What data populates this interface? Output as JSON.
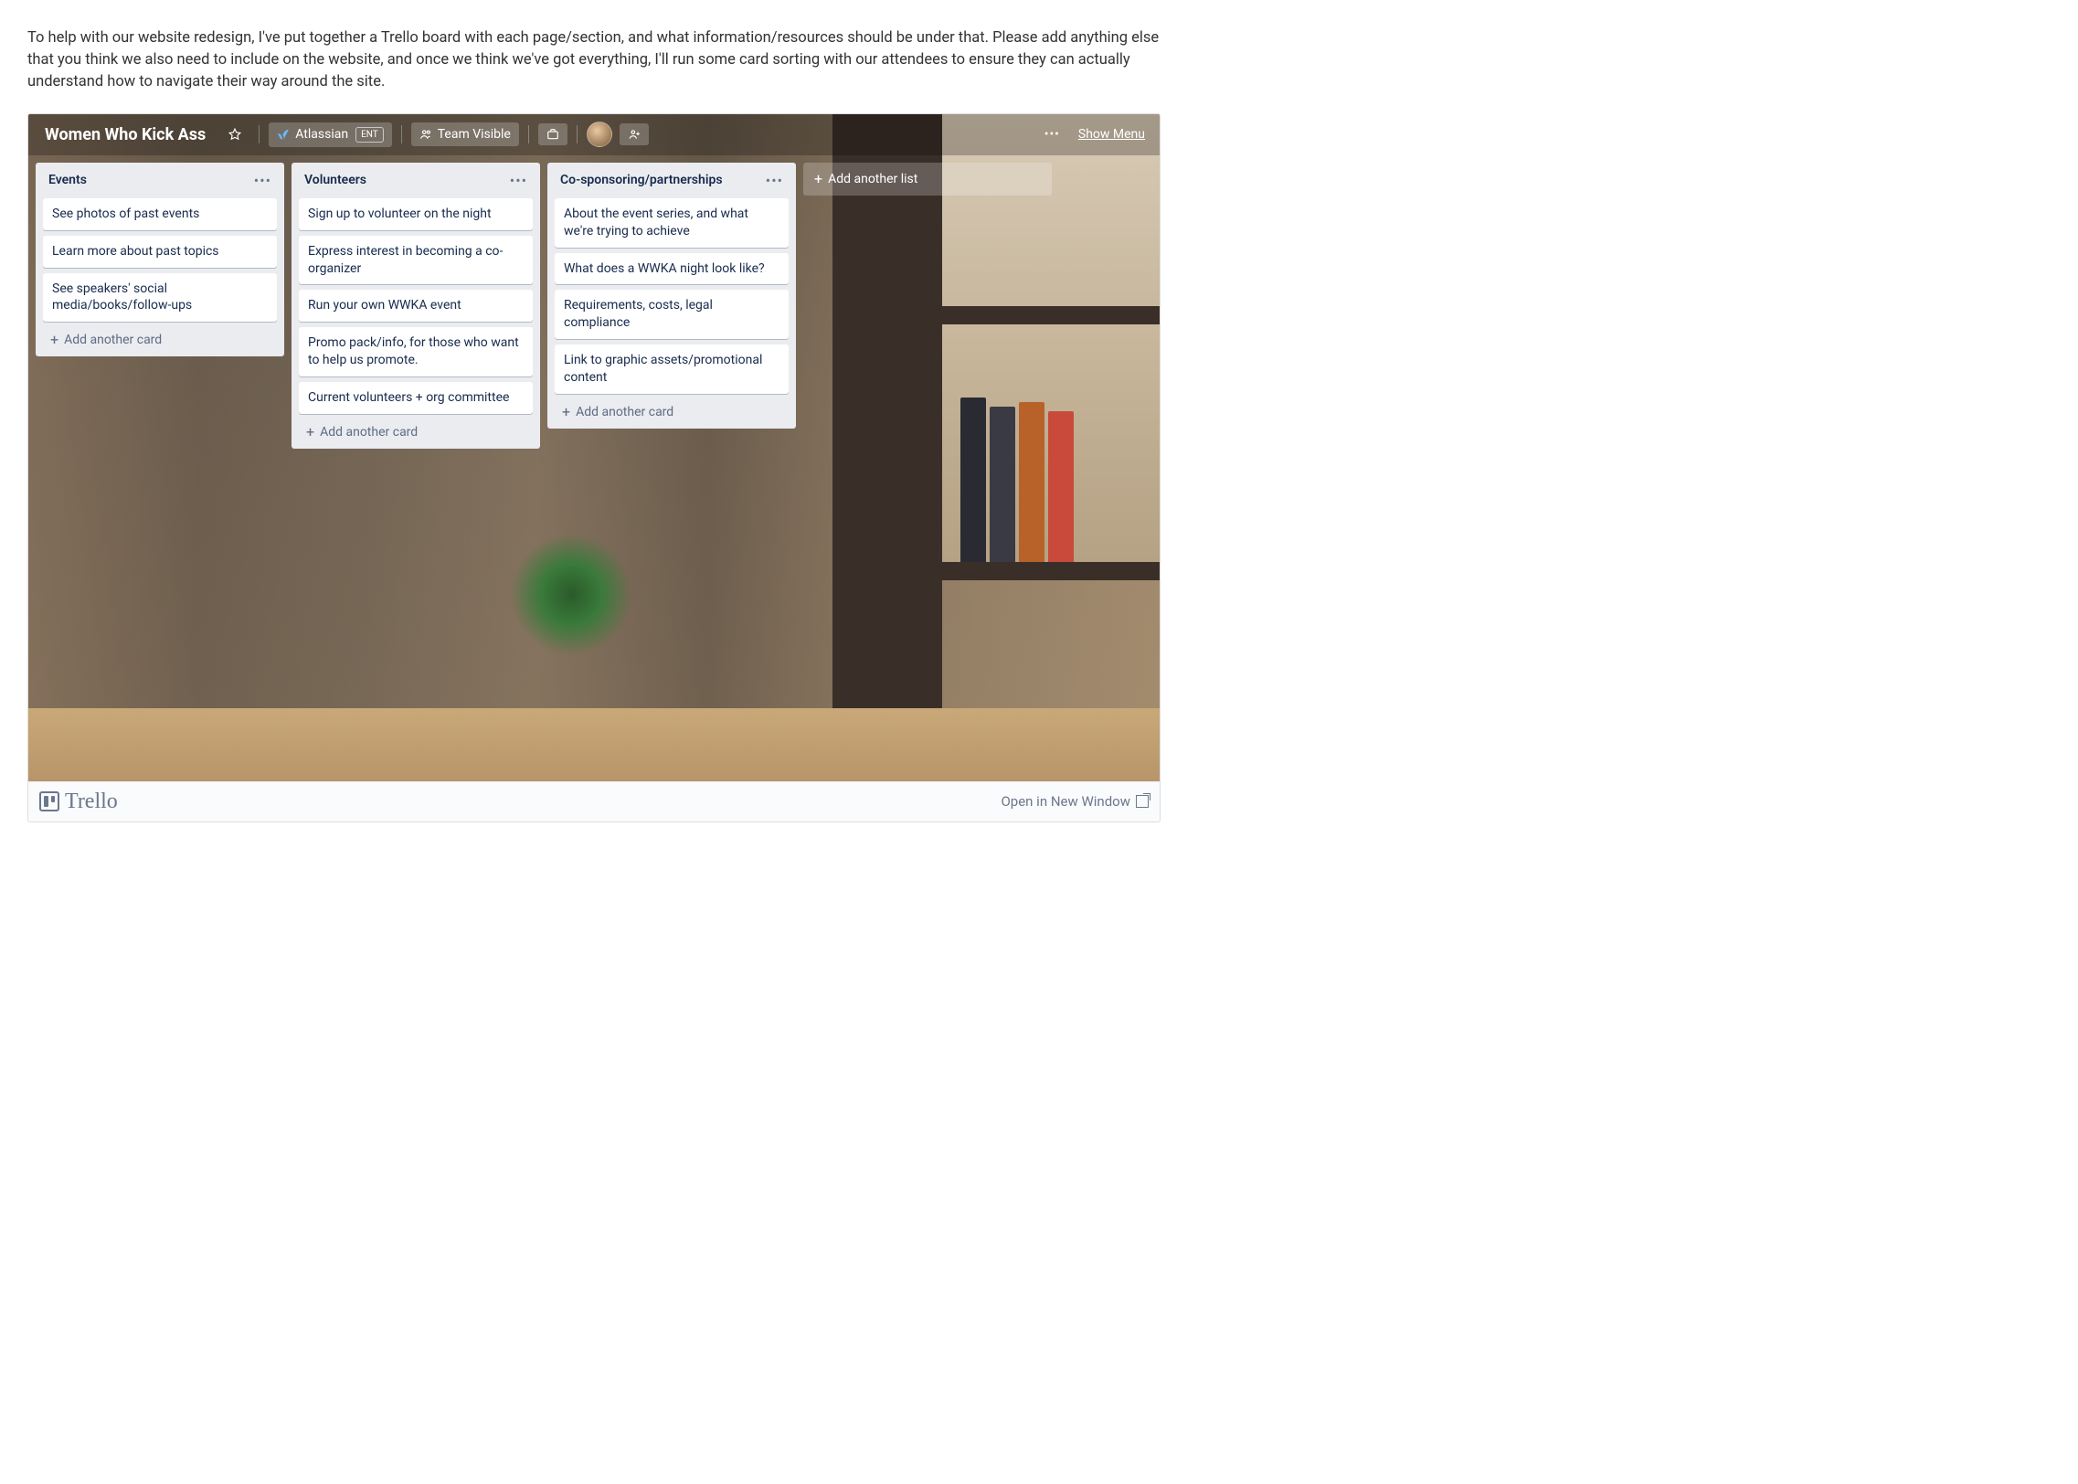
{
  "intro": "To help with our website redesign, I've put together a Trello board with each page/section, and what information/resources should be under that. Please add anything else that you think we also need to include on the website, and once we think we've got everything, I'll run some card sorting with our attendees to ensure they can actually understand how to navigate their way around the site.",
  "board": {
    "title": "Women Who Kick Ass",
    "org": "Atlassian",
    "org_badge": "ENT",
    "visibility": "Team Visible",
    "show_menu": "Show Menu"
  },
  "lists": [
    {
      "title": "Events",
      "cards": [
        "See photos of past events",
        "Learn more about past topics",
        "See speakers' social media/books/follow-ups"
      ],
      "add_label": "Add another card"
    },
    {
      "title": "Volunteers",
      "cards": [
        "Sign up to volunteer on the night",
        "Express interest in becoming a co-organizer",
        "Run your own WWKA event",
        "Promo pack/info, for those who want to help us promote.",
        "Current volunteers + org committee"
      ],
      "add_label": "Add another card"
    },
    {
      "title": "Co-sponsoring/partnerships",
      "cards": [
        "About the event series, and what we're trying to achieve",
        "What does a WWKA night look like?",
        "Requirements, costs, legal compliance",
        "Link to graphic assets/promotional content"
      ],
      "add_label": "Add another card"
    }
  ],
  "add_list_label": "Add another list",
  "footer": {
    "brand": "Trello",
    "open_label": "Open in New Window"
  }
}
